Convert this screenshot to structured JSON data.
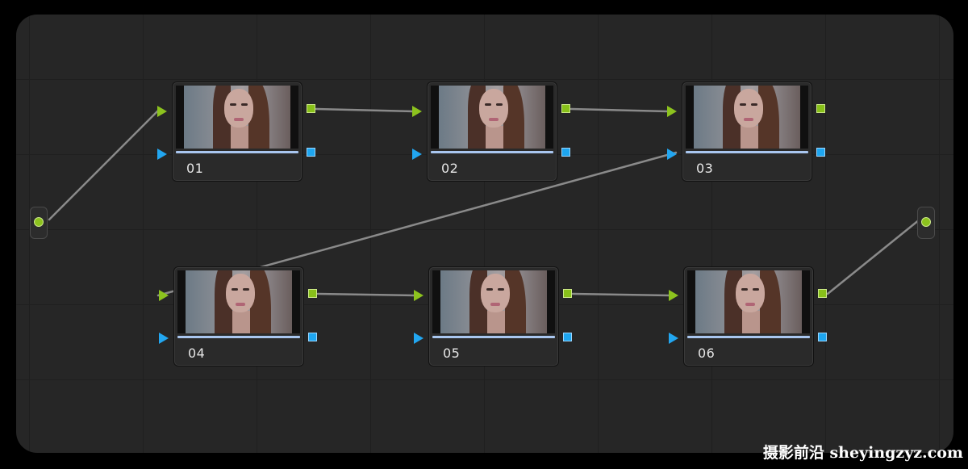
{
  "nodes": [
    {
      "label": "01"
    },
    {
      "label": "02"
    },
    {
      "label": "03"
    },
    {
      "label": "04"
    },
    {
      "label": "05"
    },
    {
      "label": "06"
    }
  ],
  "watermark": "摄影前沿 sheyingzyz.com",
  "colors": {
    "rgb_port": "#8cc21e",
    "key_port": "#22a6f0",
    "wire": "#8a8a8a",
    "canvas": "#262626"
  }
}
